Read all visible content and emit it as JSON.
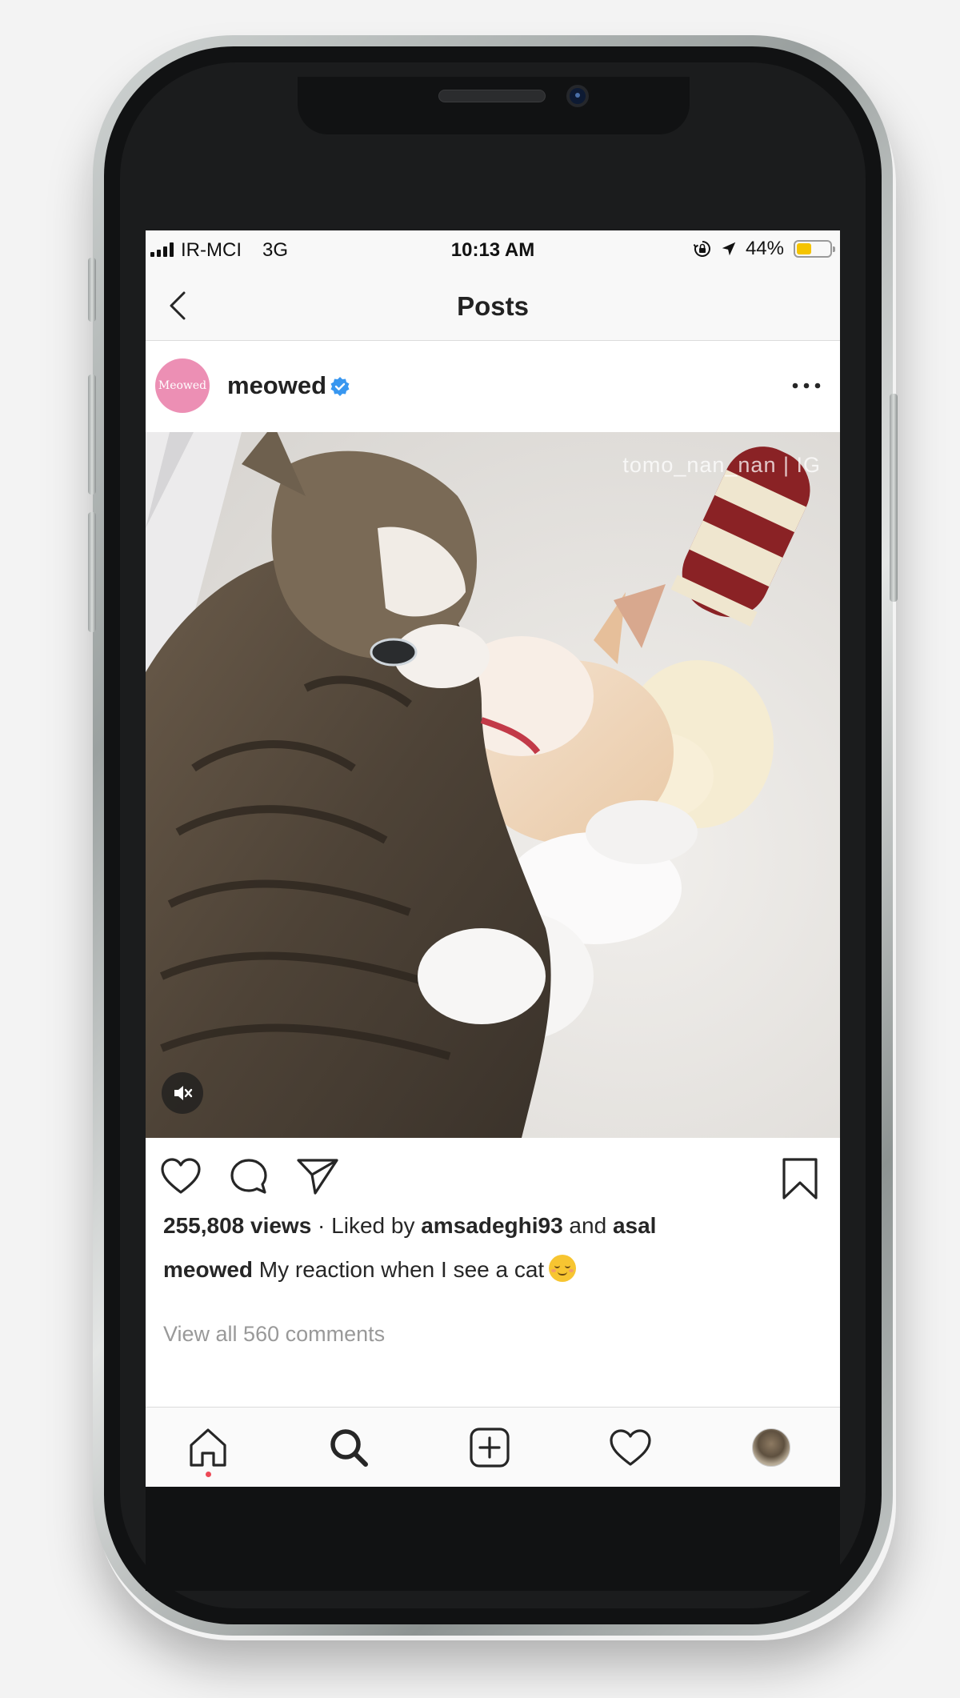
{
  "status_bar": {
    "carrier": "IR-MCI",
    "network": "3G",
    "time": "10:13 AM",
    "battery_percent": "44%",
    "battery_level": 0.44,
    "battery_color": "#f5c400"
  },
  "nav": {
    "title": "Posts",
    "back_icon": "chevron-left-icon"
  },
  "post": {
    "avatar_text": "Meowed",
    "avatar_color": "#ec8fb4",
    "username": "meowed",
    "verified_color": "#3897f0",
    "more_icon": "more-horizontal-icon",
    "video_watermark": "tomo_nan_nan | IG",
    "mute_icon": "speaker-muted-icon",
    "views": "255,808 views",
    "liked_by_prefix": " · Liked by ",
    "liked_user_1": "amsadeghi93",
    "liked_and": " and ",
    "liked_user_2": "asal",
    "caption_user": "meowed",
    "caption_text": " My reaction when I see a cat",
    "caption_emoji": "relieved-face-emoji",
    "view_comments": "View all 560 comments"
  },
  "actions": [
    "heart-icon",
    "comment-icon",
    "share-icon",
    "bookmark-icon"
  ],
  "tab_bar": {
    "items": [
      "home-icon",
      "search-icon",
      "add-post-icon",
      "heart-icon",
      "profile-avatar"
    ],
    "active": "home",
    "active_dot_color": "#ed4956"
  }
}
